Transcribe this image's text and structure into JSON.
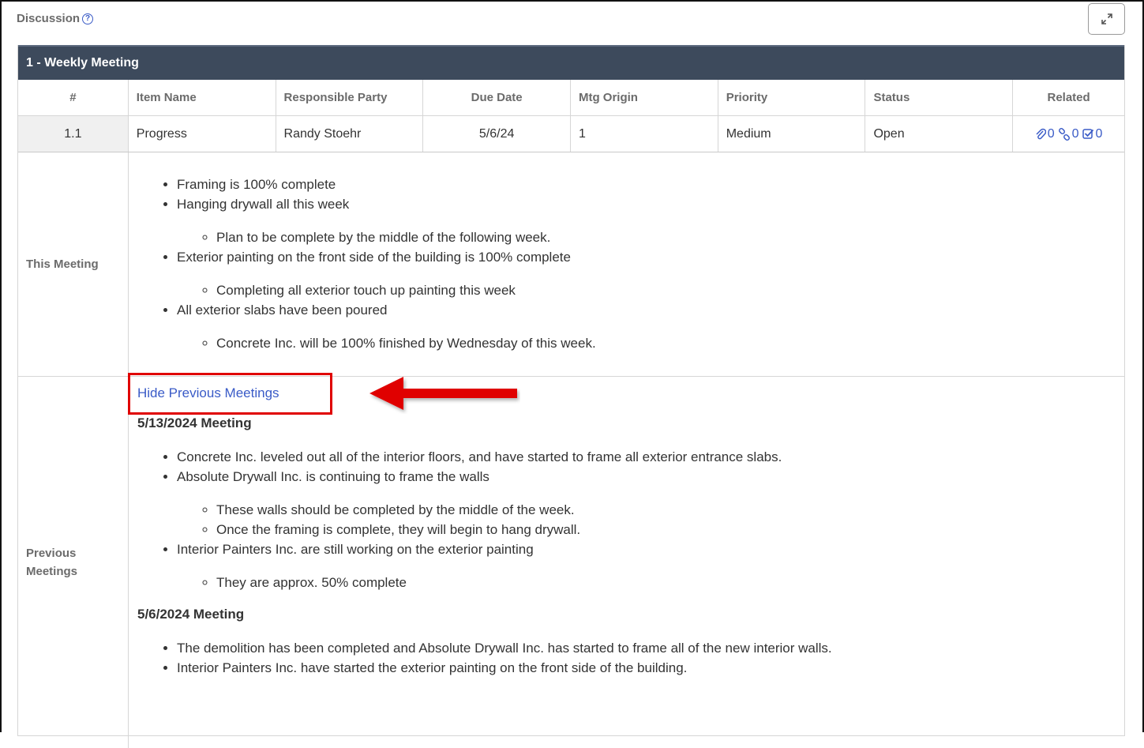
{
  "section": {
    "title": "Discussion",
    "help_icon": "question-circle-icon",
    "expand_icon": "expand-icon"
  },
  "meeting": {
    "header": "1 - Weekly Meeting"
  },
  "columns": [
    "#",
    "Item Name",
    "Responsible Party",
    "Due Date",
    "Mtg Origin",
    "Priority",
    "Status",
    "Related"
  ],
  "row": {
    "num": "1.1",
    "item_name": "Progress",
    "responsible": "Randy Stoehr",
    "due_date": "5/6/24",
    "mtg_origin": "1",
    "priority": "Medium",
    "status": "Open",
    "related": {
      "attachments": "0",
      "links": "0",
      "tasks": "0"
    }
  },
  "this_meeting": {
    "label": "This Meeting",
    "items": [
      {
        "text": "Framing is 100% complete",
        "sub": []
      },
      {
        "text": "Hanging drywall all this week",
        "sub": [
          "Plan to be complete by the middle of the following week."
        ]
      },
      {
        "text": "Exterior painting on the front side of the building is 100% complete",
        "sub": [
          "Completing all exterior touch up painting this week"
        ]
      },
      {
        "text": "All exterior slabs have been poured",
        "sub": [
          "Concrete Inc. will be 100% finished by Wednesday of this week."
        ]
      }
    ]
  },
  "previous": {
    "label_line1": "Previous",
    "label_line2": "Meetings",
    "hide_link": "Hide Previous Meetings",
    "meetings": [
      {
        "heading": "5/13/2024 Meeting",
        "items": [
          {
            "text": "Concrete Inc. leveled out all of the interior floors, and have started to frame all exterior entrance slabs.",
            "sub": []
          },
          {
            "text": "Absolute Drywall Inc. is continuing to frame the walls",
            "sub": [
              "These walls should be completed by the middle of the week.",
              "Once the framing is complete, they will begin to hang drywall."
            ]
          },
          {
            "text": "Interior Painters Inc. are still working on the exterior painting",
            "sub": [
              "They are approx. 50% complete"
            ]
          }
        ]
      },
      {
        "heading": "5/6/2024 Meeting",
        "items": [
          {
            "text": "The demolition has been completed and Absolute Drywall Inc. has started to frame all of the new interior walls.",
            "sub": []
          },
          {
            "text": "Interior Painters Inc. have started the exterior painting on the front side of the building.",
            "sub": []
          }
        ]
      }
    ]
  },
  "colors": {
    "header_bg": "#3d4a5c",
    "link": "#3a5bc7",
    "highlight": "#e00000"
  }
}
